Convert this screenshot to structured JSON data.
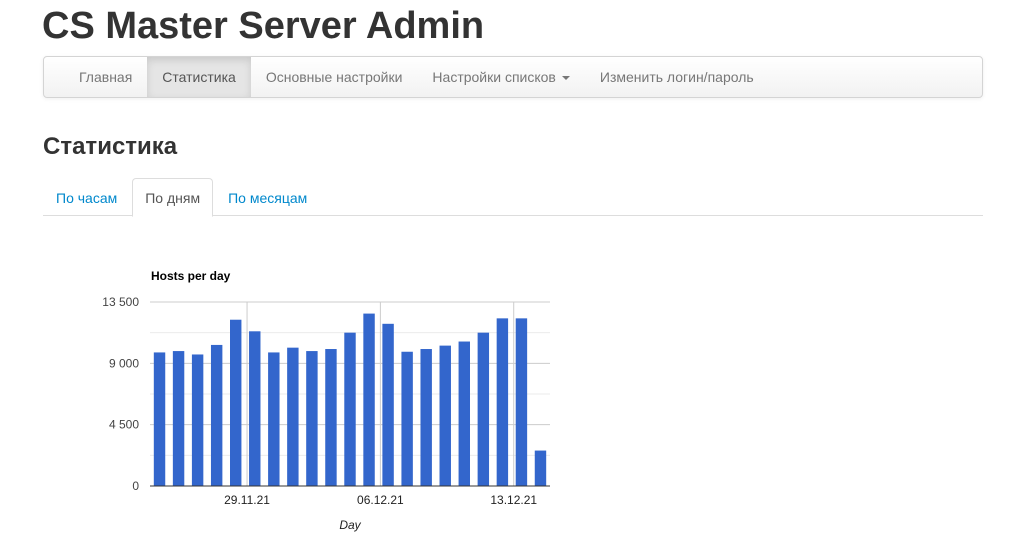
{
  "header": {
    "title": "CS Master Server Admin"
  },
  "nav": {
    "items": [
      {
        "label": "Главная",
        "active": false
      },
      {
        "label": "Статистика",
        "active": true
      },
      {
        "label": "Основные настройки",
        "active": false
      },
      {
        "label": "Настройки списков",
        "active": false,
        "dropdown": true
      },
      {
        "label": "Изменить логин/пароль",
        "active": false
      }
    ]
  },
  "page": {
    "heading": "Статистика"
  },
  "tabs": [
    {
      "label": "По часам",
      "active": false
    },
    {
      "label": "По дням",
      "active": true
    },
    {
      "label": "По месяцам",
      "active": false
    }
  ],
  "colors": {
    "bar": "#3366cc",
    "link": "#0088cc"
  },
  "chart_data": {
    "type": "bar",
    "title": "Hosts per day",
    "xlabel": "Day",
    "ylabel": "",
    "ylim": [
      0,
      13500
    ],
    "yticks": [
      0,
      4500,
      9000,
      13500
    ],
    "ytick_labels": [
      "0",
      "4 500",
      "9 000",
      "13 500"
    ],
    "x_ticks": [
      {
        "label": "29.11.21",
        "index": 5
      },
      {
        "label": "06.12.21",
        "index": 12
      },
      {
        "label": "13.12.21",
        "index": 19
      }
    ],
    "grid": true,
    "legend": "none",
    "values": [
      9800,
      9900,
      9650,
      10350,
      12200,
      11350,
      9800,
      10150,
      9900,
      10050,
      11250,
      12650,
      11900,
      9850,
      10050,
      10300,
      10600,
      11250,
      12300,
      12300,
      2600
    ]
  }
}
